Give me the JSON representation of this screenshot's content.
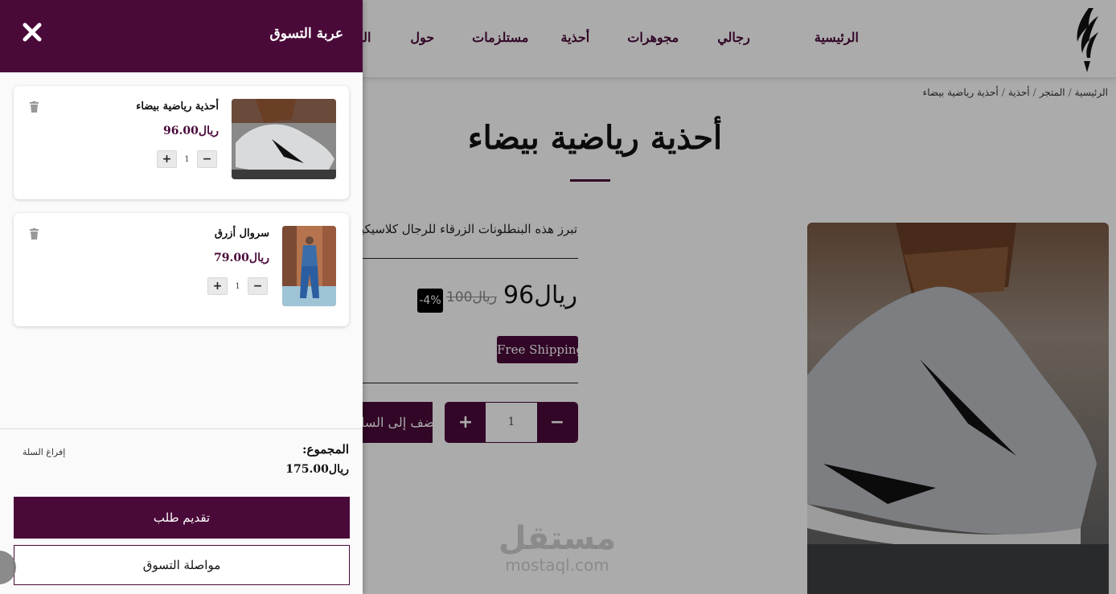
{
  "header": {
    "nav": [
      "الرئيسية",
      "رجالي",
      "مجوهرات",
      "أحذية",
      "مستلزمات",
      "حول",
      "الخدمات",
      "ال"
    ]
  },
  "breadcrumb": {
    "items": [
      "الرئيسية",
      "المتجر",
      "أحذية",
      "أحذية رياضية بيضاء"
    ],
    "separator": "/"
  },
  "product": {
    "title": "أحذية رياضية بيضاء",
    "description": "تبرز هذه البنطلونات الزرقاء للرجال كلاسيكية عصرية",
    "price": "ريال96",
    "old_price": "ريال100",
    "discount": "-4%",
    "free_shipping": "Free Shipping",
    "quantity": "1",
    "add_to_cart": "أضف إلى السلة",
    "minus": "−",
    "plus": "+"
  },
  "watermark": {
    "line1": "مستقل",
    "line2": "mostaql.com"
  },
  "cart": {
    "title": "عربة التسوق",
    "items": [
      {
        "name": "أحذية رياضية بيضاء",
        "price": "ريال96.00",
        "quantity": "1"
      },
      {
        "name": "سروال أزرق",
        "price": "ريال79.00",
        "quantity": "1"
      }
    ],
    "total_label": "المجموع:",
    "total_value": "ريال175.00",
    "empty_cart": "إفراغ السلة",
    "checkout": "تقديم طلب",
    "continue_shopping": "مواصلة التسوق"
  },
  "colors": {
    "brand": "#4a0a39",
    "overlay": "rgba(0,0,0,0.33)"
  },
  "icons": [
    "logo-icon",
    "close-icon",
    "trash-icon",
    "plus-icon",
    "minus-icon"
  ]
}
